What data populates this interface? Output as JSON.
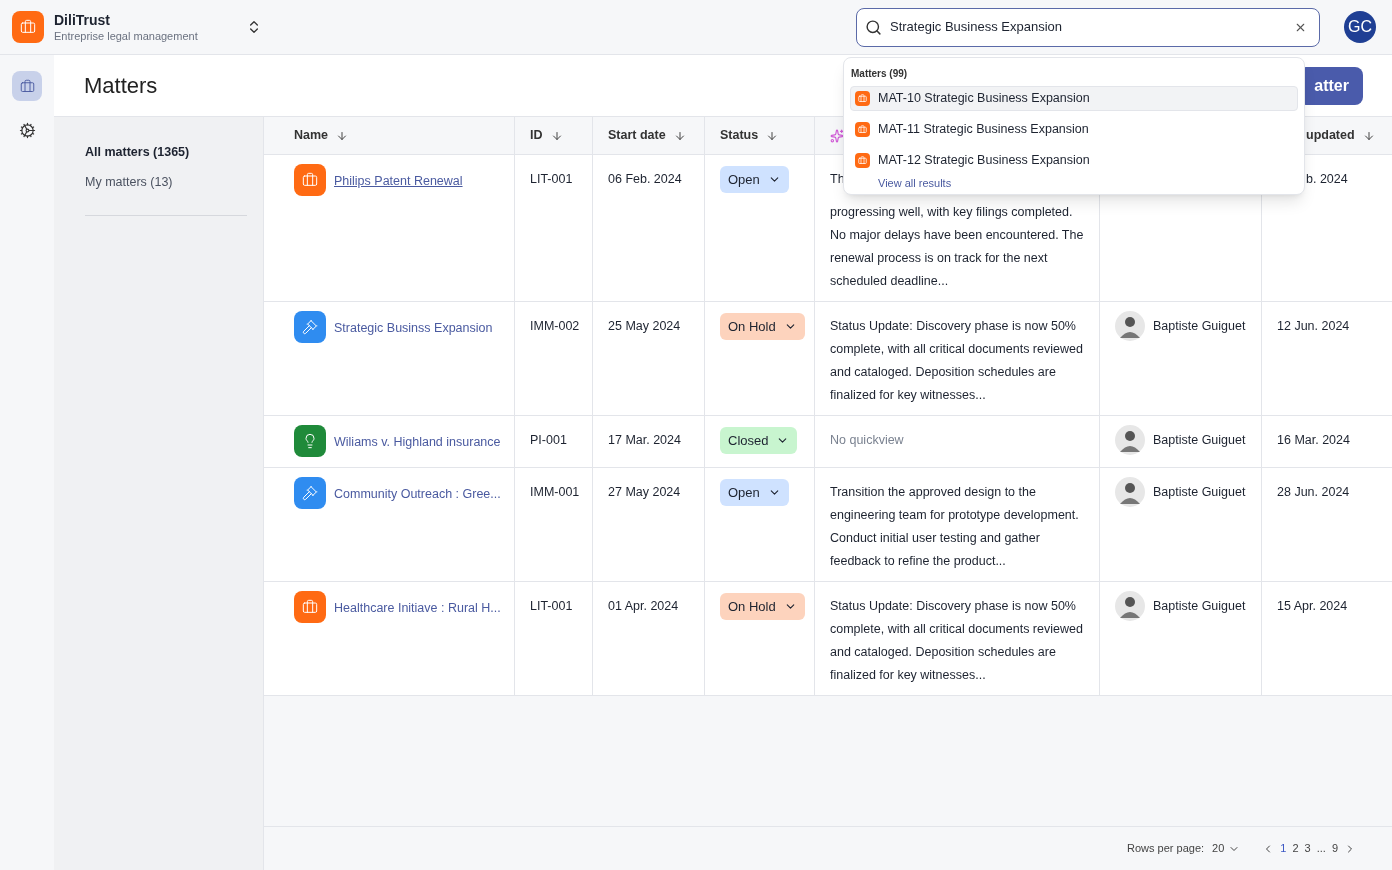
{
  "app": {
    "name": "DiliTrust",
    "subtitle": "Entreprise legal management"
  },
  "search": {
    "value": "Strategic Business Expansion"
  },
  "user": {
    "initials": "GC"
  },
  "rail": [
    {
      "kind": "briefcase",
      "selected": true
    },
    {
      "kind": "gears",
      "selected": false
    }
  ],
  "page_title": "Matters",
  "new_button": "atter",
  "filters": [
    {
      "label": "All matters (1365)",
      "selected": true
    },
    {
      "label": "My matters (13)",
      "selected": false
    }
  ],
  "columns": [
    {
      "label": "Name"
    },
    {
      "label": "ID"
    },
    {
      "label": "Start date"
    },
    {
      "label": "Status"
    },
    {
      "kind": "sparkle"
    },
    {
      "kind": "hidden"
    },
    {
      "label": "updated"
    }
  ],
  "rows": [
    {
      "kind": "briefcase",
      "name": "Philips Patent Renewal",
      "visited": true,
      "id": "LIT-001",
      "start": "06 Feb. 2024",
      "status": {
        "kind": "open",
        "label": "Open"
      },
      "quickview_fragment": "Th",
      "quickview": "progressing well, with key filings completed. No major delays have been encountered. The renewal process is on track for the next scheduled deadline...",
      "updated": "b. 2024"
    },
    {
      "kind": "gavel",
      "name": "Strategic Businss Expansion",
      "visited": false,
      "id": "IMM-002",
      "start": "25 May 2024",
      "status": {
        "kind": "on_hold",
        "label": "On Hold"
      },
      "quickview": "Status Update: Discovery phase is now 50% complete, with all critical documents reviewed and cataloged. Deposition schedules are finalized for key witnesses...",
      "owner": "Baptiste Guiguet",
      "updated": "12 Jun. 2024"
    },
    {
      "kind": "bulb",
      "name": "Wiliams v. Highland insurance",
      "visited": false,
      "id": "PI-001",
      "start": "17 Mar. 2024",
      "status": {
        "kind": "closed",
        "label": "Closed"
      },
      "quickview_empty": "No quickview",
      "owner": "Baptiste Guiguet",
      "updated": "16 Mar. 2024"
    },
    {
      "kind": "gavel",
      "name": "Community Outreach : Gree...",
      "visited": false,
      "id": "IMM-001",
      "start": "27 May 2024",
      "status": {
        "kind": "open",
        "label": "Open"
      },
      "quickview": "Transition the approved design to the engineering team for prototype development. Conduct initial user testing and gather feedback to refine the product...",
      "owner": "Baptiste Guiguet",
      "updated": "28 Jun. 2024"
    },
    {
      "kind": "briefcase",
      "name": "Healthcare Initiave : Rural H...",
      "visited": false,
      "id": "LIT-001",
      "start": "01 Apr. 2024",
      "status": {
        "kind": "on_hold",
        "label": "On Hold"
      },
      "quickview": "Status Update: Discovery phase is now 50% complete, with all critical documents reviewed and cataloged. Deposition schedules are finalized for key witnesses...",
      "owner": "Baptiste Guiguet",
      "updated": "15 Apr. 2024"
    }
  ],
  "pagination": {
    "rows_label": "Rows per page:",
    "rows_value": "20",
    "pages": [
      {
        "label": "1",
        "selected": true
      },
      {
        "label": "2",
        "selected": false
      },
      {
        "label": "3",
        "selected": false
      },
      {
        "label": "...",
        "selected": false
      },
      {
        "label": "9",
        "selected": false
      }
    ]
  },
  "dropdown": {
    "heading": "Matters (99)",
    "results": [
      {
        "label": "MAT-10 Strategic Business Expansion",
        "selected": true
      },
      {
        "label": "MAT-11 Strategic Business Expansion",
        "selected": false
      },
      {
        "label": "MAT-12 Strategic Business Expansion",
        "selected": false
      }
    ],
    "link": "View all results"
  }
}
